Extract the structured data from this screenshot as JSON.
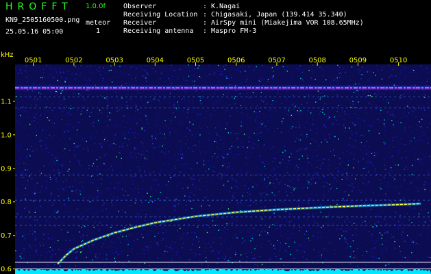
{
  "header": {
    "app_title": "HROFFT",
    "version": "1.0.0f",
    "filename": "KN9_2505160500.png",
    "mode_label": "meteor",
    "mode_value": "1",
    "datetime": "25.05.16 05:00",
    "info_rows": [
      {
        "label": "Observer",
        "sep": ":",
        "value": "K.Nagai"
      },
      {
        "label": "Receiving Location",
        "sep": ":",
        "value": "Chigasaki, Japan (139.414 35.340)"
      },
      {
        "label": "Receiver",
        "sep": ":",
        "value": "AirSpy mini (Miakejima VOR 108.65MHz)"
      },
      {
        "label": "Receiving antenna",
        "sep": ":",
        "value": "Maspro FM-3"
      }
    ]
  },
  "chart_data": {
    "type": "heatmap",
    "ylabel": "kHz",
    "y_ticks": [
      0.6,
      0.7,
      0.8,
      0.9,
      1.0,
      1.1
    ],
    "y_tick_labels": [
      "0.6",
      "0.7",
      "0.8",
      "0.9",
      "1.0",
      "1.1"
    ],
    "ylim": [
      0.585,
      1.21
    ],
    "x_tick_labels": [
      "0501",
      "0502",
      "0503",
      "0504",
      "0505",
      "0506",
      "0507",
      "0508",
      "0509",
      "0510"
    ],
    "xlim": [
      0.55,
      10.8
    ],
    "carrier_khz": 1.14,
    "faint_lines_khz": [
      1.113,
      1.08,
      0.88,
      0.805,
      0.755,
      0.73
    ],
    "horizontal_lines_khz": [
      0.62,
      0.6
    ],
    "meteor_trace": {
      "x": [
        1.6,
        1.8,
        2.0,
        2.5,
        3.0,
        3.5,
        4.0,
        5.0,
        6.0,
        7.0,
        8.0,
        9.0,
        10.0,
        10.55
      ],
      "khz": [
        0.615,
        0.64,
        0.66,
        0.687,
        0.708,
        0.724,
        0.738,
        0.757,
        0.769,
        0.777,
        0.783,
        0.788,
        0.792,
        0.795
      ]
    },
    "colors": {
      "background": "#0c0c52",
      "noise": [
        "#1515a0",
        "#2a30d0",
        "#00d8d8",
        "#40ff60"
      ],
      "carrier": "#ff50ff",
      "trace": "#ffff40",
      "axis_text": "#ffff00",
      "lines": "#ffffff",
      "bottom_band": "#00e8ff"
    }
  }
}
